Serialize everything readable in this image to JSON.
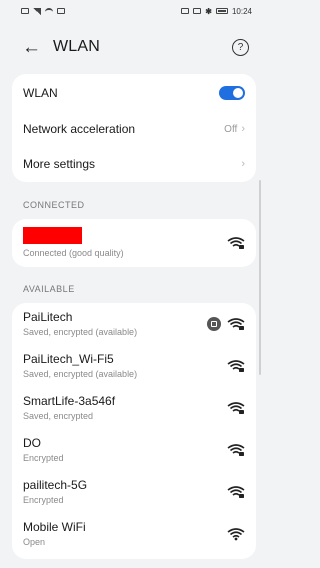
{
  "status_bar": {
    "time": "10:24",
    "battery": "86"
  },
  "header": {
    "title": "WLAN"
  },
  "settings": {
    "wlan_label": "WLAN",
    "wlan_on": true,
    "network_acceleration_label": "Network acceleration",
    "network_acceleration_value": "Off",
    "more_settings_label": "More settings"
  },
  "connected": {
    "header": "CONNECTED",
    "status": "Connected (good quality)"
  },
  "available": {
    "header": "AVAILABLE",
    "networks": [
      {
        "name": "PaiLitech",
        "status": "Saved, encrypted (available)",
        "icon": "wifi-lock-icon",
        "shared": true
      },
      {
        "name": "PaiLitech_Wi-Fi5",
        "status": "Saved, encrypted (available)",
        "icon": "wifi-lock-icon"
      },
      {
        "name": "SmartLife-3a546f",
        "status": "Saved, encrypted",
        "icon": "wifi-lock-icon"
      },
      {
        "name": "DO",
        "status": "Encrypted",
        "icon": "wifi-lock-icon"
      },
      {
        "name": "pailitech-5G",
        "status": "Encrypted",
        "icon": "wifi-lock-icon"
      },
      {
        "name": "Mobile WiFi",
        "status": "Open",
        "icon": "wifi-icon"
      }
    ]
  }
}
